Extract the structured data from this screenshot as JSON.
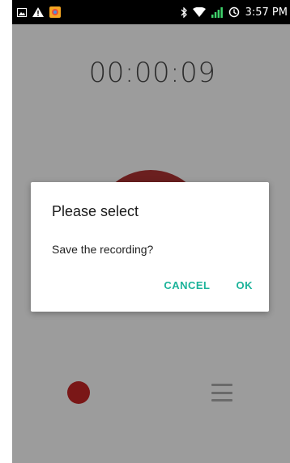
{
  "status_bar": {
    "time": "3:57 PM",
    "icons": [
      "image-notification-icon",
      "warning-icon",
      "app-notification-icon",
      "bluetooth-icon",
      "wifi-icon",
      "signal-icon",
      "data-saver-icon"
    ]
  },
  "recorder": {
    "elapsed": "00:00:09"
  },
  "dialog": {
    "title": "Please select",
    "message": "Save the recording?",
    "cancel_label": "CANCEL",
    "ok_label": "OK"
  },
  "colors": {
    "accent": "#1bb39a",
    "record_red": "#7a1717",
    "scrim_bg": "#9c9c9c"
  }
}
